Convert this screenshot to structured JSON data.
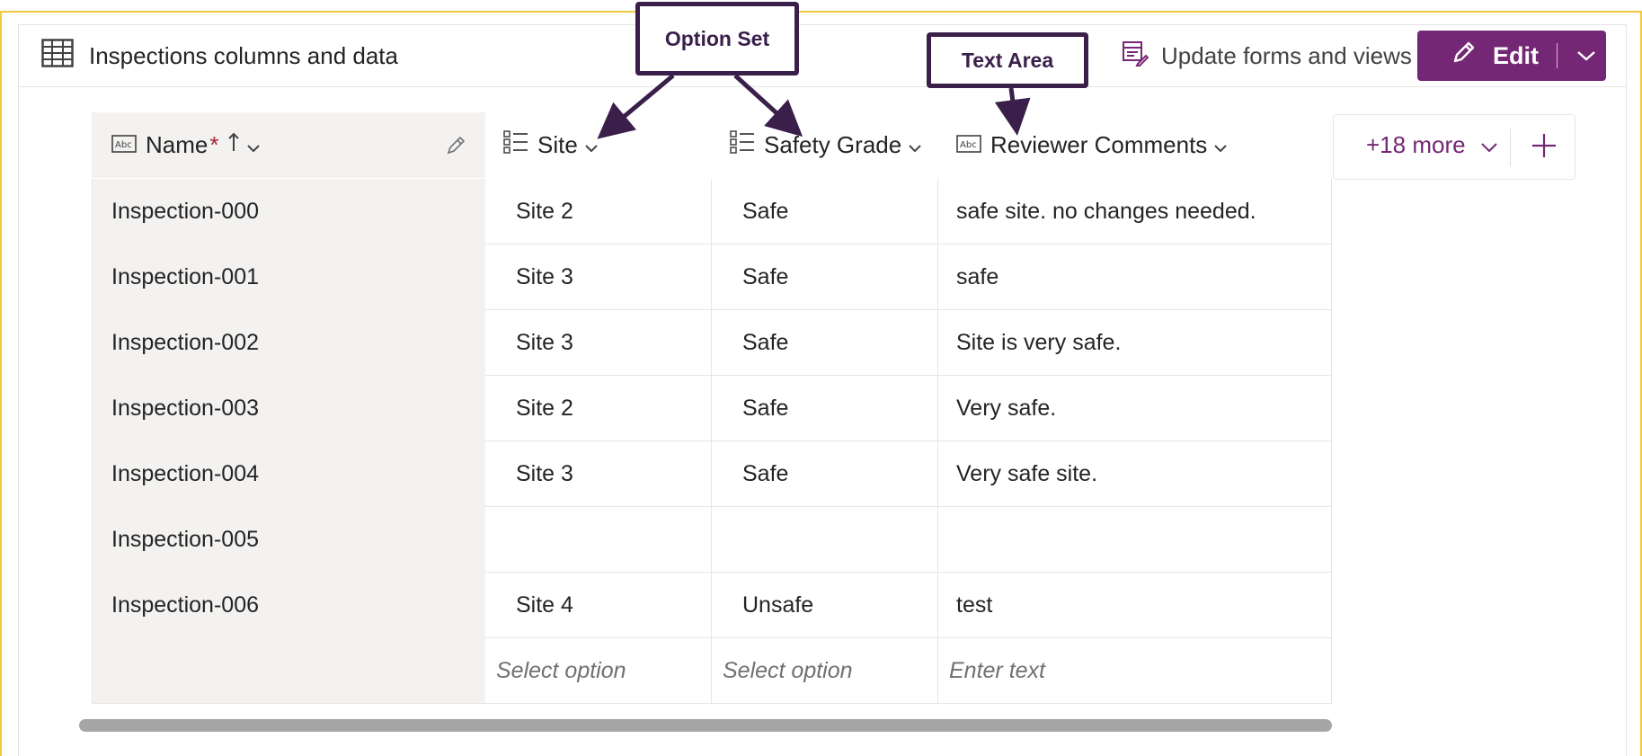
{
  "header": {
    "title": "Inspections columns and data",
    "update_label": "Update forms and views",
    "edit_label": "Edit"
  },
  "columns": {
    "name": {
      "label": "Name",
      "required": "*"
    },
    "site": {
      "label": "Site"
    },
    "safety": {
      "label": "Safety Grade"
    },
    "comments": {
      "label": "Reviewer Comments"
    }
  },
  "more_columns_label": "+18 more",
  "rows": [
    {
      "name": "Inspection-000",
      "site": "Site 2",
      "safety": "Safe",
      "comments": "safe site. no changes needed."
    },
    {
      "name": "Inspection-001",
      "site": "Site 3",
      "safety": "Safe",
      "comments": "safe"
    },
    {
      "name": "Inspection-002",
      "site": "Site 3",
      "safety": "Safe",
      "comments": "Site is very safe."
    },
    {
      "name": "Inspection-003",
      "site": "Site 2",
      "safety": "Safe",
      "comments": "Very safe."
    },
    {
      "name": "Inspection-004",
      "site": "Site 3",
      "safety": "Safe",
      "comments": "Very safe site."
    },
    {
      "name": "Inspection-005",
      "site": "",
      "safety": "",
      "comments": ""
    },
    {
      "name": "Inspection-006",
      "site": "Site 4",
      "safety": "Unsafe",
      "comments": "test"
    }
  ],
  "new_row": {
    "site_placeholder": "Select option",
    "safety_placeholder": "Select option",
    "comments_placeholder": "Enter text"
  },
  "callouts": {
    "option_set": "Option Set",
    "text_area": "Text Area"
  },
  "colors": {
    "accent": "#742774",
    "callout": "#3a1f4a",
    "frame": "#f0c93c",
    "name_column_bg": "#f3f2f1"
  }
}
